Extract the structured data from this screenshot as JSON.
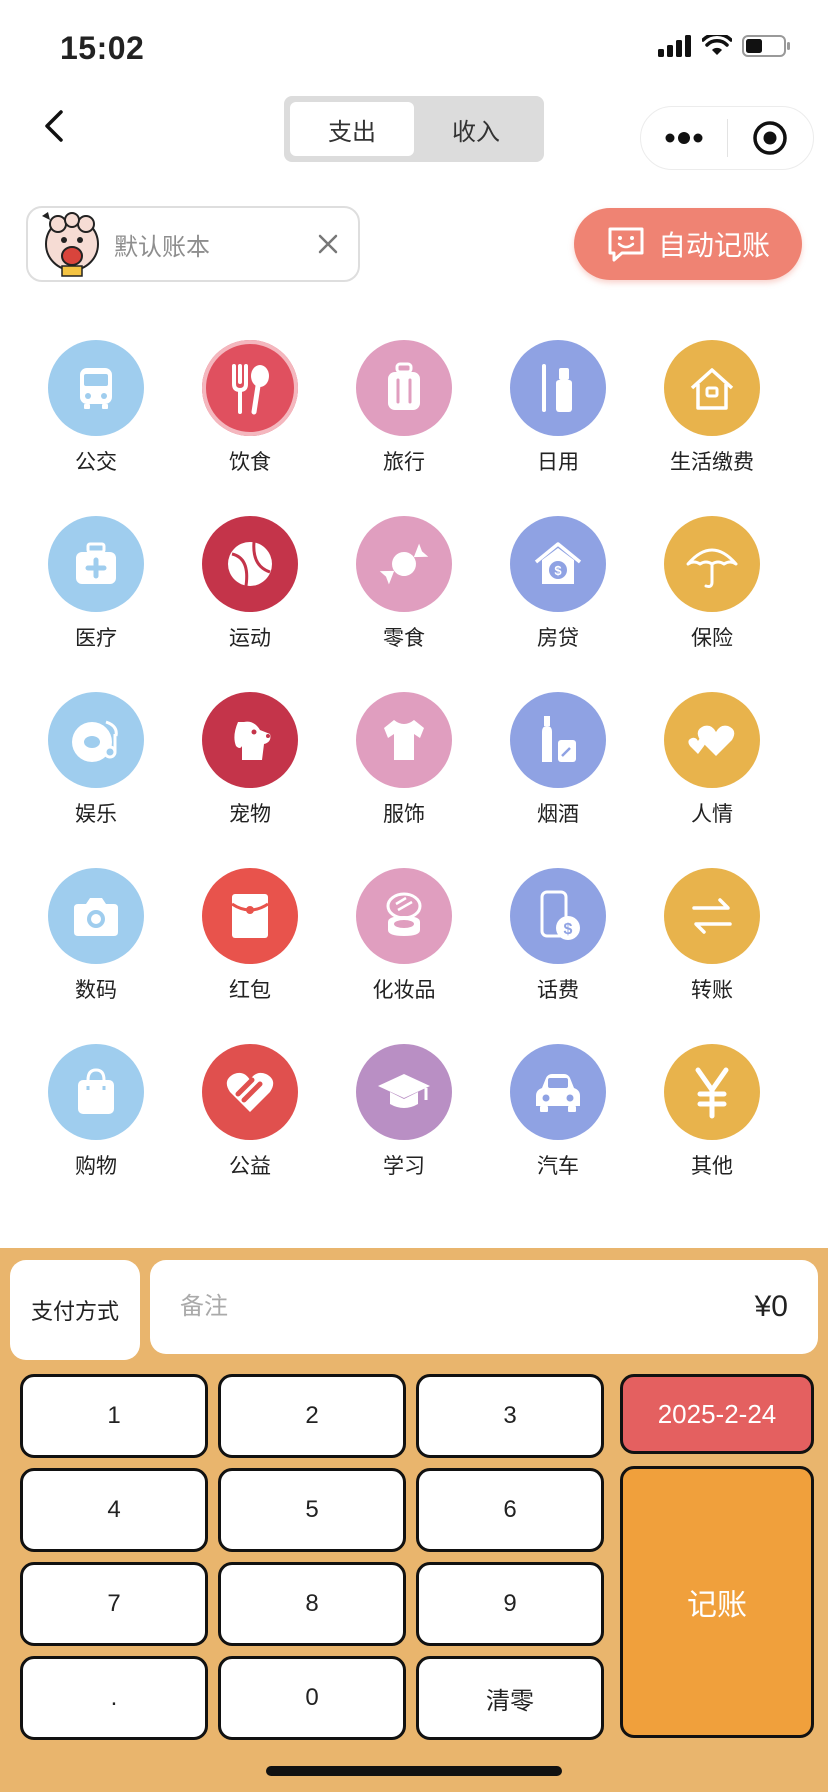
{
  "status_bar": {
    "time": "15:02"
  },
  "nav": {
    "tabs": [
      {
        "label": "支出",
        "active": true
      },
      {
        "label": "收入",
        "active": false
      }
    ]
  },
  "ledger": {
    "name": "默认账本"
  },
  "auto_record": {
    "label": "自动记账"
  },
  "categories": [
    {
      "label": "公交",
      "icon": "bus-icon",
      "color": "#9fcdee"
    },
    {
      "label": "饮食",
      "icon": "fork-spoon-icon",
      "color": "#e0505f",
      "selected": true
    },
    {
      "label": "旅行",
      "icon": "suitcase-icon",
      "color": "#e09ebf"
    },
    {
      "label": "日用",
      "icon": "toothbrush-icon",
      "color": "#8fa2e3"
    },
    {
      "label": "生活缴费",
      "icon": "house-icon",
      "color": "#e8b34c"
    },
    {
      "label": "医疗",
      "icon": "medical-kit-icon",
      "color": "#9fcdee"
    },
    {
      "label": "运动",
      "icon": "ball-icon",
      "color": "#c4344a"
    },
    {
      "label": "零食",
      "icon": "candy-icon",
      "color": "#e09ebf"
    },
    {
      "label": "房贷",
      "icon": "house-dollar-icon",
      "color": "#8fa2e3"
    },
    {
      "label": "保险",
      "icon": "umbrella-icon",
      "color": "#e8b34c"
    },
    {
      "label": "娱乐",
      "icon": "music-disc-icon",
      "color": "#9fcdee"
    },
    {
      "label": "宠物",
      "icon": "dog-icon",
      "color": "#c4344a"
    },
    {
      "label": "服饰",
      "icon": "shirt-icon",
      "color": "#e09ebf"
    },
    {
      "label": "烟酒",
      "icon": "bottle-icon",
      "color": "#8fa2e3"
    },
    {
      "label": "人情",
      "icon": "hearts-icon",
      "color": "#e8b34c"
    },
    {
      "label": "数码",
      "icon": "camera-icon",
      "color": "#9fcdee"
    },
    {
      "label": "红包",
      "icon": "red-envelope-icon",
      "color": "#e8534c"
    },
    {
      "label": "化妆品",
      "icon": "compact-icon",
      "color": "#e09ebf"
    },
    {
      "label": "话费",
      "icon": "phone-dollar-icon",
      "color": "#8fa2e3"
    },
    {
      "label": "转账",
      "icon": "transfer-icon",
      "color": "#e8b34c"
    },
    {
      "label": "购物",
      "icon": "shopping-bag-icon",
      "color": "#9fcdee"
    },
    {
      "label": "公益",
      "icon": "charity-heart-icon",
      "color": "#e0504e"
    },
    {
      "label": "学习",
      "icon": "graduation-cap-icon",
      "color": "#b98fc4"
    },
    {
      "label": "汽车",
      "icon": "car-icon",
      "color": "#8fa2e3"
    },
    {
      "label": "其他",
      "icon": "yen-icon",
      "color": "#e8b34c"
    }
  ],
  "keypad": {
    "pay_method": "支付方式",
    "note_placeholder": "备注",
    "amount": "¥0",
    "keys": [
      "1",
      "2",
      "3",
      "4",
      "5",
      "6",
      "7",
      "8",
      "9",
      ".",
      "0",
      "清零"
    ],
    "date": "2025-2-24",
    "submit": "记账"
  }
}
